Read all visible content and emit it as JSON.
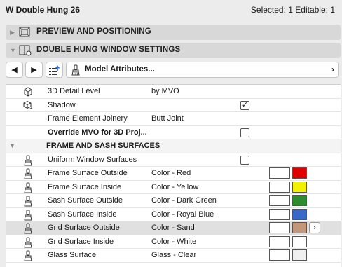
{
  "header": {
    "title": "W Double Hung 26",
    "status": "Selected: 1 Editable: 1"
  },
  "sections": {
    "preview": {
      "label": "PREVIEW AND POSITIONING",
      "arrow": "▶"
    },
    "settings": {
      "label": "DOUBLE HUNG WINDOW SETTINGS",
      "arrow": "▼"
    }
  },
  "toolbar": {
    "back": "◀",
    "forward": "▶",
    "model_label": "Model Attributes...",
    "chevron": "›"
  },
  "rows": {
    "detail": {
      "name": "3D Detail Level",
      "value": "by MVO"
    },
    "shadow": {
      "name": "Shadow",
      "checked": "✓"
    },
    "joinery": {
      "name": "Frame Element Joinery",
      "value": "Butt Joint"
    },
    "override": {
      "name": "Override MVO for 3D Proj..."
    },
    "group": {
      "label": "FRAME AND SASH SURFACES",
      "arrow": "▼"
    },
    "uniform": {
      "name": "Uniform Window Surfaces"
    },
    "frame_out": {
      "name": "Frame Surface Outside",
      "value": "Color - Red",
      "color": "#e00000"
    },
    "frame_in": {
      "name": "Frame Surface Inside",
      "value": "Color - Yellow",
      "color": "#f2f200"
    },
    "sash_out": {
      "name": "Sash Surface Outside",
      "value": "Color - Dark Green",
      "color": "#2e8b2e"
    },
    "sash_in": {
      "name": "Sash Surface Inside",
      "value": "Color - Royal Blue",
      "color": "#3a68c8"
    },
    "grid_out": {
      "name": "Grid Surface Outside",
      "value": "Color - Sand",
      "color": "#c2977a",
      "arrow": "›"
    },
    "grid_in": {
      "name": "Grid Surface Inside",
      "value": "Color - White",
      "color": "#ffffff"
    },
    "glass": {
      "name": "Glass Surface",
      "value": "Glass - Clear",
      "color": "#f0f0f0"
    }
  }
}
